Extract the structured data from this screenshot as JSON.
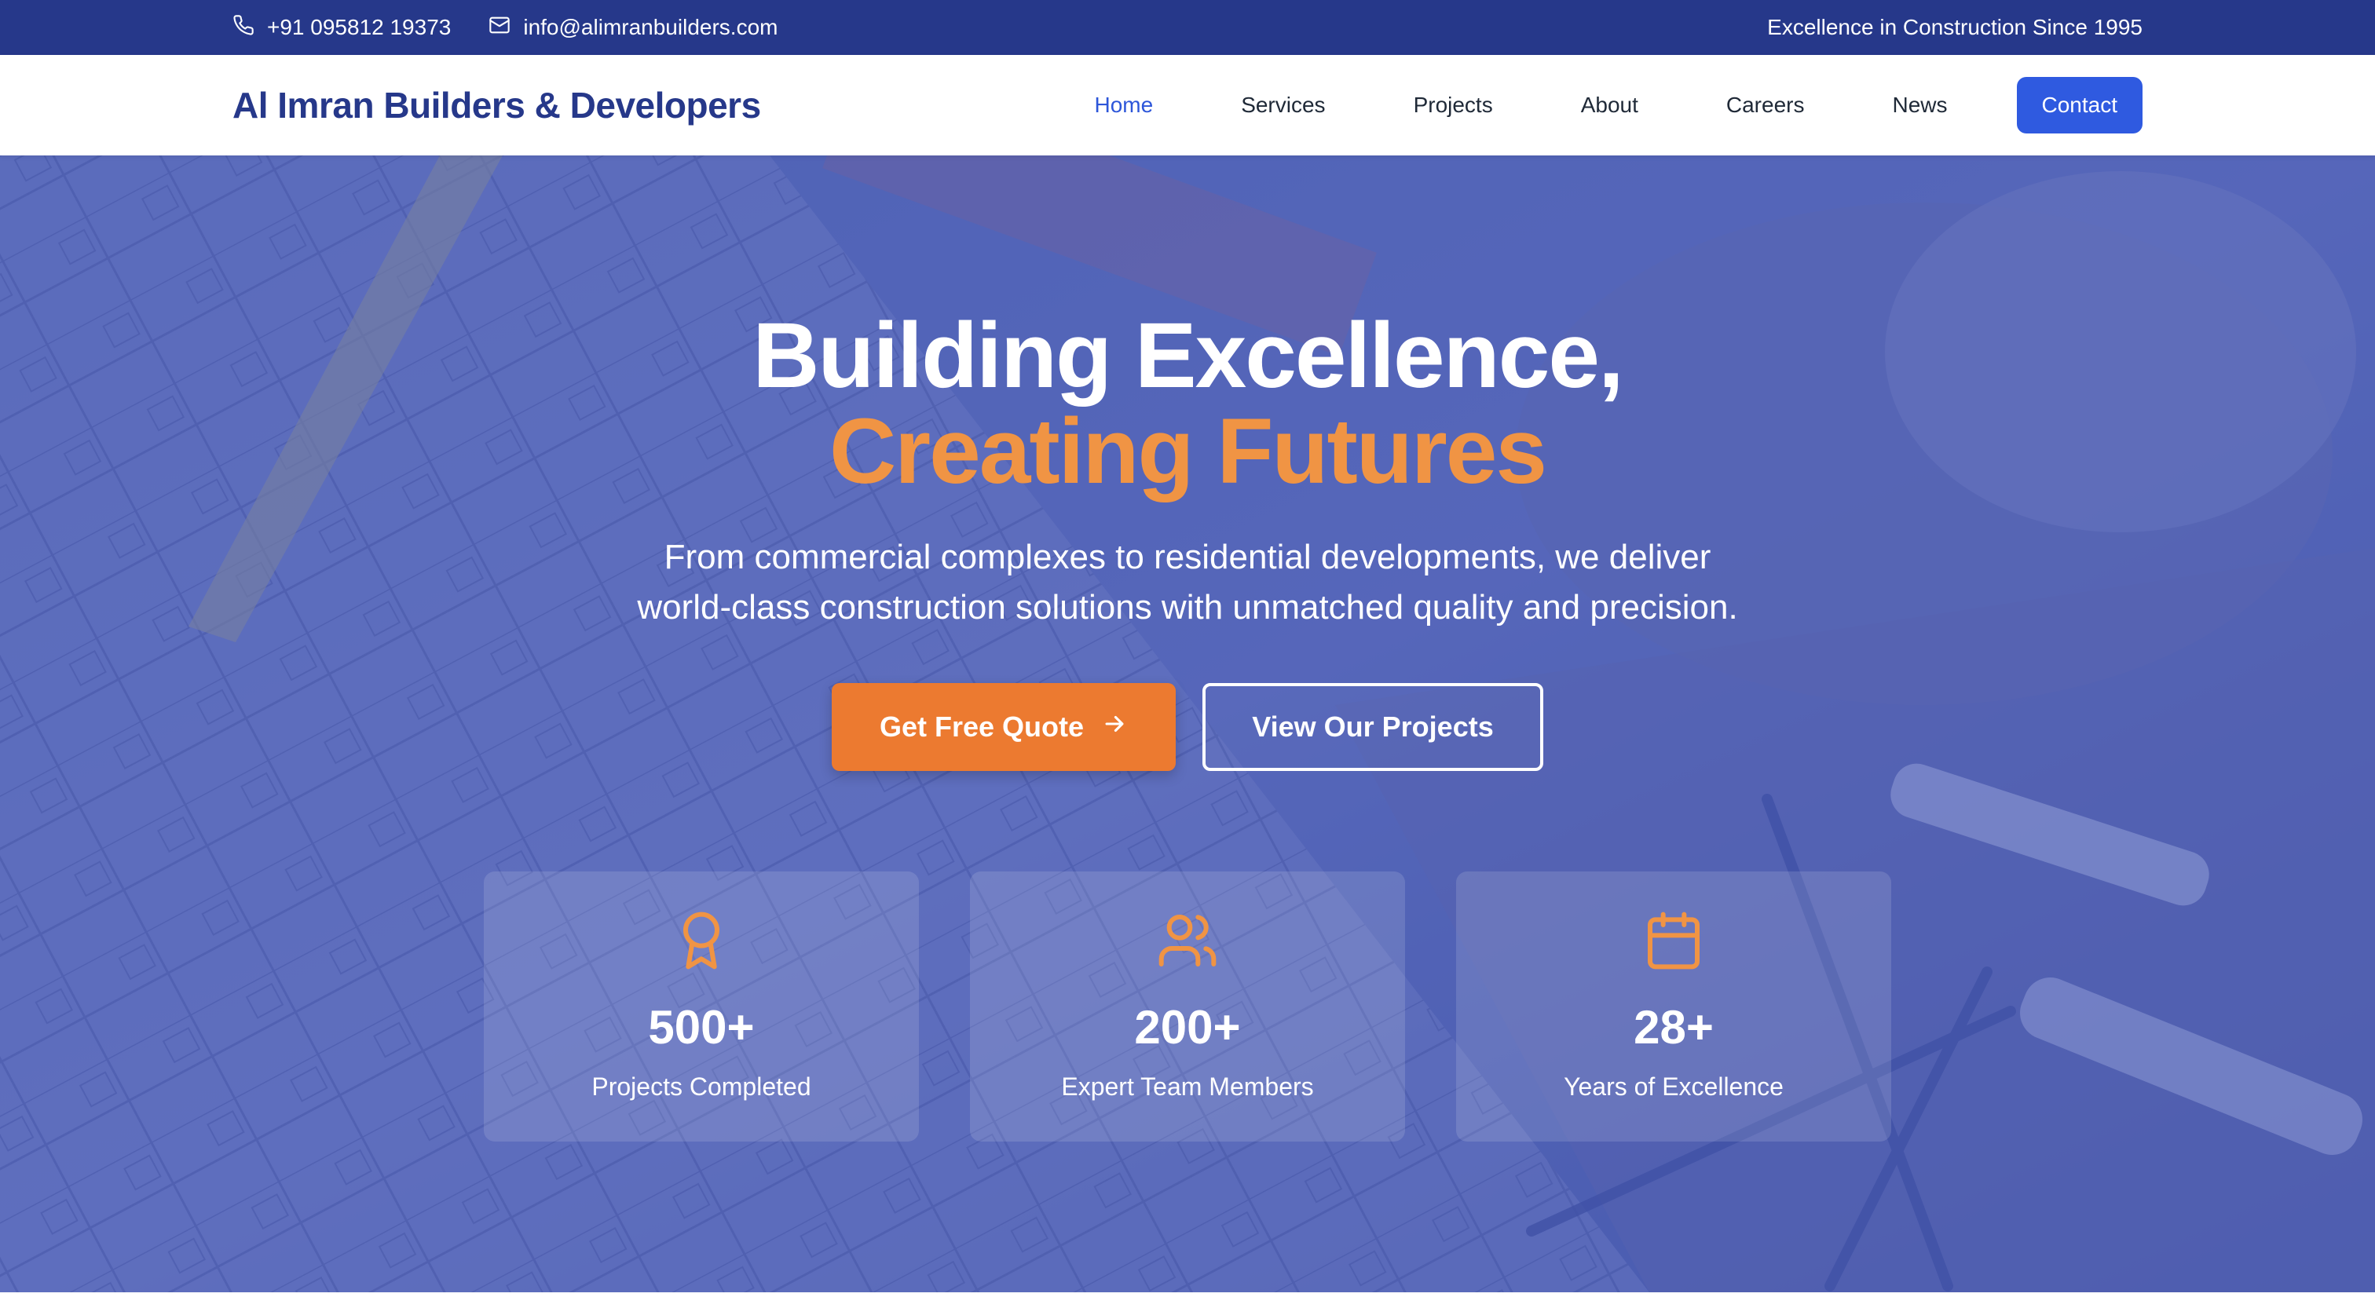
{
  "topbar": {
    "phone": "+91 095812 19373",
    "email": "info@alimranbuilders.com",
    "tagline": "Excellence in Construction Since 1995"
  },
  "nav": {
    "brand": "Al Imran Builders & Developers",
    "links": [
      "Home",
      "Services",
      "Projects",
      "About",
      "Careers",
      "News"
    ],
    "active": "Home",
    "contact_label": "Contact"
  },
  "hero": {
    "title_line1": "Building Excellence,",
    "title_line2": "Creating Futures",
    "subtitle_line1": "From commercial complexes to residential developments, we deliver",
    "subtitle_line2": "world-class construction solutions with unmatched quality and precision.",
    "primary_cta": "Get Free Quote",
    "secondary_cta": "View Our Projects"
  },
  "stats": [
    {
      "icon": "award-icon",
      "value": "500+",
      "label": "Projects Completed"
    },
    {
      "icon": "users-icon",
      "value": "200+",
      "label": "Expert Team Members"
    },
    {
      "icon": "calendar-icon",
      "value": "28+",
      "label": "Years of Excellence"
    }
  ],
  "colors": {
    "primary": "#26388a",
    "accent": "#ec7a30",
    "button_blue": "#2f5ae0",
    "highlight": "#f09444"
  }
}
